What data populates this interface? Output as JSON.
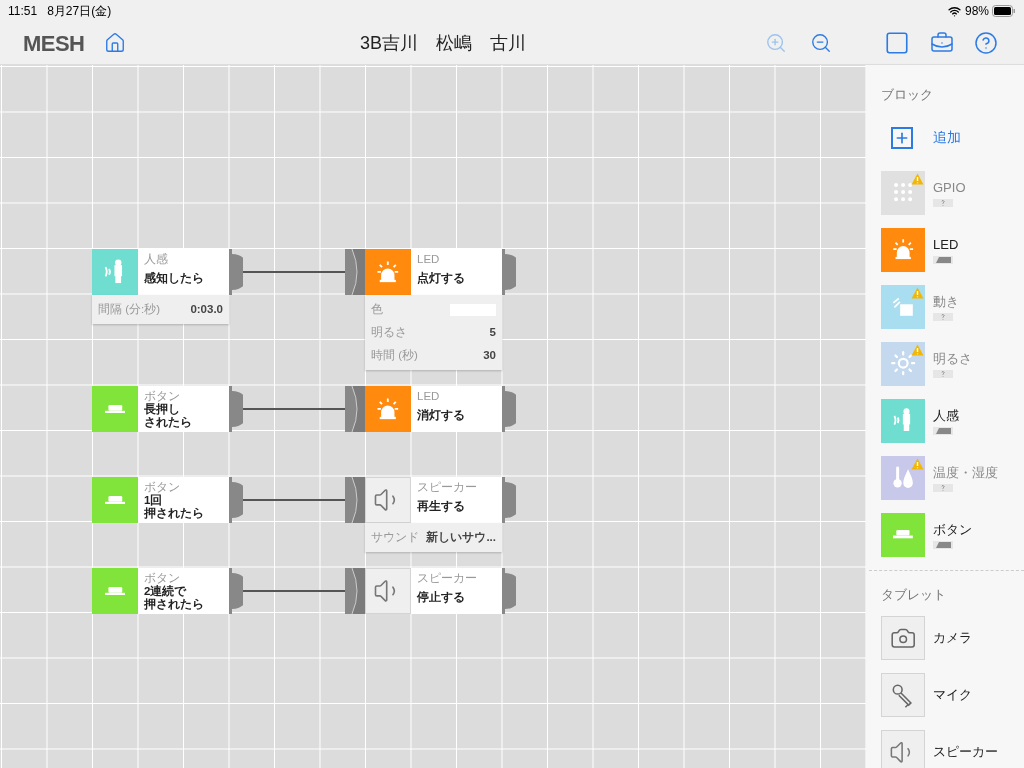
{
  "status_bar": {
    "time": "11:51",
    "date": "8月27日(金)",
    "battery": "98%"
  },
  "header": {
    "logo": "MESH",
    "title": "3B吉川　松嶋　古川",
    "zoom_in_disabled": true
  },
  "rules": [
    {
      "trigger": {
        "kind": "motion",
        "type_label": "人感",
        "action_lines": [
          "感知したら"
        ],
        "params": [
          {
            "kind": "text",
            "label": "間隔 (分:秒)",
            "value": "0:03.0"
          }
        ]
      },
      "action": {
        "kind": "led",
        "type_label": "LED",
        "action_lines": [
          "点灯する"
        ],
        "params": [
          {
            "kind": "color",
            "label": "色",
            "color": "#ffffff"
          },
          {
            "kind": "text",
            "label": "明るさ",
            "value": "5"
          },
          {
            "kind": "text",
            "label": "時間 (秒)",
            "value": "30"
          }
        ]
      }
    },
    {
      "trigger": {
        "kind": "button",
        "type_label": "ボタン",
        "action_lines": [
          "長押し",
          "されたら"
        ]
      },
      "action": {
        "kind": "led",
        "type_label": "LED",
        "action_lines": [
          "消灯する"
        ]
      }
    },
    {
      "trigger": {
        "kind": "button",
        "type_label": "ボタン",
        "action_lines": [
          "1回",
          "押されたら"
        ]
      },
      "action": {
        "kind": "speaker",
        "type_label": "スピーカー",
        "action_lines": [
          "再生する"
        ],
        "params": [
          {
            "kind": "text",
            "label": "サウンド",
            "value": "新しいサウ..."
          }
        ]
      }
    },
    {
      "trigger": {
        "kind": "button",
        "type_label": "ボタン",
        "action_lines": [
          "2連続で",
          "押されたら"
        ]
      },
      "action": {
        "kind": "speaker",
        "type_label": "スピーカー",
        "action_lines": [
          "停止する"
        ]
      }
    }
  ],
  "sidebar": {
    "blocks_heading": "ブロック",
    "add_label": "追加",
    "blocks": [
      {
        "kind": "gpio",
        "label": "GPIO",
        "connected": false
      },
      {
        "kind": "led",
        "label": "LED",
        "connected": true
      },
      {
        "kind": "move",
        "label": "動き",
        "connected": false
      },
      {
        "kind": "brightness",
        "label": "明るさ",
        "connected": false
      },
      {
        "kind": "motion",
        "label": "人感",
        "connected": true
      },
      {
        "kind": "temperature",
        "label": "温度・湿度",
        "connected": false
      },
      {
        "kind": "button",
        "label": "ボタン",
        "connected": true
      }
    ],
    "tablet_heading": "タブレット",
    "tablet": [
      {
        "kind": "camera",
        "label": "カメラ"
      },
      {
        "kind": "mic",
        "label": "マイク"
      },
      {
        "kind": "speaker",
        "label": "スピーカー"
      }
    ]
  }
}
